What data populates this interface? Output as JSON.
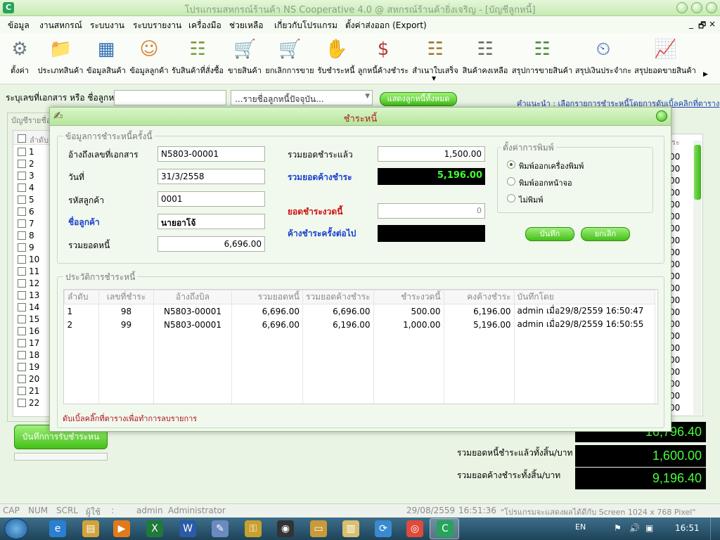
{
  "window": {
    "title": "โปรแกรมสหกรณ์ร้านค้า NS Cooperative 4.0 @ สหกรณ์ร้านค้ายิ่งเจริญ - [บัญชีลูกหนี้]"
  },
  "menu": [
    "ข้อมูล",
    "งานสหกรณ์",
    "ระบบงาน",
    "ระบบรายงาน",
    "เครื่องมือ",
    "ช่วยเหลือ",
    "เกี่ยวกับโปรแกรม",
    "ตั้งค่าส่งออก (Export)"
  ],
  "mdi_controls": [
    "_",
    "🗗",
    "×"
  ],
  "toolbar": [
    {
      "label": "ตั้งค่า",
      "icon": "⚙",
      "color": "#6c7a86"
    },
    {
      "label": "ประเภทสินค้า",
      "icon": "📁",
      "color": "#e8a54a"
    },
    {
      "label": "ข้อมูลสินค้า",
      "icon": "▦",
      "color": "#2f6fb3"
    },
    {
      "label": "ข้อมูลลูกค้า",
      "icon": "☺",
      "color": "#d9883a"
    },
    {
      "label": "รับสินค้าที่สั่งซื้อ",
      "icon": "☷",
      "color": "#7a9a3a"
    },
    {
      "label": "ขายสินค้า",
      "icon": "🛒",
      "color": "#6a6a6a"
    },
    {
      "label": "ยกเลิกการขาย",
      "icon": "🛒",
      "color": "#c03a2a"
    },
    {
      "label": "รับชำระหนี้",
      "icon": "✋",
      "color": "#d0983a"
    },
    {
      "label": "ลูกหนี้ค้างชำระ",
      "icon": "$",
      "color": "#b03a3a"
    },
    {
      "label": "สำเนาใบเสร็จ",
      "icon": "☷",
      "color": "#9a7a2a"
    },
    {
      "label": "สินค้าคงเหลือ",
      "icon": "☷",
      "color": "#6a6a6a"
    },
    {
      "label": "สรุปการขายสินค้า",
      "icon": "☷",
      "color": "#4a8a3a"
    },
    {
      "label": "สรุปเงินประจำกะ",
      "icon": "⏲",
      "color": "#3a6ab0"
    },
    {
      "label": "สรุปยอดขายสินค้า",
      "icon": "📈",
      "color": "#3aa03a"
    }
  ],
  "search": {
    "label": "ระบุเลขที่เอกสาร หรือ ชื่อลูกหนี้",
    "value": "",
    "dropdown": "...รายชื่อลูกหนี้ปัจจุบัน...",
    "show_all_button": "แสดงลูกหนี้ทั้งหมด",
    "hint": "คำแนะนำ : เลือกรายการชำระหนี้โดยการดับเบิ้ลคลิกที่ตาราง"
  },
  "background": {
    "panel_legend": "บัญชีรายชื่อ",
    "col_header": "ลำดับ",
    "right_header": "ระ",
    "rows": [
      "1",
      "2",
      "3",
      "4",
      "5",
      "6",
      "7",
      "8",
      "9",
      "10",
      "11",
      "12",
      "13",
      "14",
      "15",
      "16",
      "17",
      "18",
      "19",
      "20",
      "21",
      "22"
    ],
    "right_values": [
      "00",
      "00",
      "00",
      "00",
      "00",
      "00",
      "00",
      "00",
      "00",
      "00",
      "00",
      "00",
      "00",
      "00",
      "00",
      "00",
      "00",
      "00",
      "00",
      "00",
      "00",
      "00"
    ],
    "save_button": "บันทึกการรับชำระหน",
    "total_debt_value": "16,796.40",
    "paid_label": "รวมยอดหนี้ชำระแล้วทั้งสิ้น/บาท",
    "paid_value": "1,600.00",
    "outstanding_label": "รวมยอดค้างชำระทั้งสิ้น/บาท",
    "outstanding_value": "9,196.40"
  },
  "dialog": {
    "title": "ชำระหนี้",
    "info_legend": "ข้อมูลการชำระหนี้ครั้งนี้",
    "doc_label": "อ้างถึงเลขที่เอกสาร",
    "doc_value": "N5803-00001",
    "date_label": "วันที่",
    "date_value": "31/3/2558",
    "cust_code_label": "รหัสลูกค้า",
    "cust_code_value": "0001",
    "cust_name_label": "ชื่อลูกค้า",
    "cust_name_value": "นายอาโจ้",
    "total_debt_label": "รวมยอดหนี้",
    "total_debt_value": "6,696.00",
    "paid_label": "รวมยอดชำระแล้ว",
    "paid_value": "1,500.00",
    "outstanding_label": "รวมยอดค้างชำระ",
    "outstanding_value": "5,196.00",
    "this_payment_label": "ยอดชำระงวดนี้",
    "this_payment_value": "0",
    "next_outstanding_label": "ค้างชำระครั้งต่อไป",
    "next_outstanding_value": "",
    "print_legend": "ตั้งค่าการพิมพ์",
    "print_options": [
      "พิมพ์ออกเครื่องพิมพ์",
      "พิมพ์ออกหน้าจอ",
      "ไม่พิมพ์"
    ],
    "save_button": "บันทึก",
    "cancel_button": "ยกเลิก",
    "history_legend": "ประวัติการชำระหนี้",
    "history_columns": [
      "ลำดับ",
      "เลขที่ชำระ",
      "อ้างถึงบิล",
      "รวมยอดหนี้",
      "รวมยอดค้างชำระ",
      "ชำระงวดนี้",
      "คงค้างชำระ",
      "บันทึกโดย"
    ],
    "history_rows": [
      [
        "1",
        "98",
        "N5803-00001",
        "6,696.00",
        "6,696.00",
        "500.00",
        "6,196.00",
        "admin เมื่อ29/8/2559  16:50:47"
      ],
      [
        "2",
        "99",
        "N5803-00001",
        "6,696.00",
        "6,196.00",
        "1,000.00",
        "5,196.00",
        "admin เมื่อ29/8/2559  16:50:55"
      ]
    ],
    "footer_hint": "ดับเบิ้ลคลิ๊กที่ตารางเพื่อทำการลบรายการ"
  },
  "statusbar": {
    "cap": "CAP",
    "num": "NUM",
    "scrl": "SCRL",
    "user_label": "ผู้ใช้",
    "colon": ":",
    "user": "admin",
    "role": "Administrator",
    "date": "29/08/2559",
    "time": "16:51:36",
    "msg": "\"โปรแกรมจะแสดงผลได้ดีกับ  Screen 1024 x 768 Pixel\""
  },
  "taskbar": {
    "lang": "EN",
    "clock": "16:51"
  }
}
